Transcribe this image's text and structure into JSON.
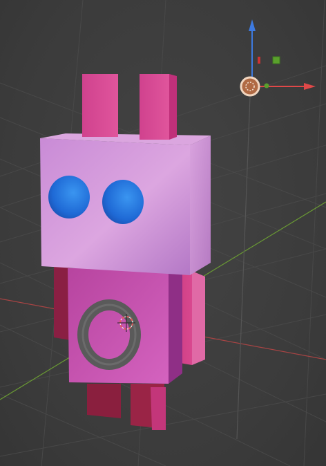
{
  "viewport": {
    "background": "#3d3d3d",
    "grid_color": "#4a4a4a",
    "axis_x_color": "#b54a4a",
    "axis_y_color": "#6f9a3a"
  },
  "gizmo": {
    "z_axis_color": "#4a7fe0",
    "x_axis_color": "#e04a4a",
    "light_icon": "sun-lamp-icon",
    "camera_indicator_color": "#5aa02c",
    "x_label_color": "#c33"
  },
  "robot": {
    "head_color": "#d69ad6",
    "body_color": "#c04fae",
    "ears_color": "#d6438f",
    "eyes_color": "#2f7fe0",
    "ring_color": "#5a5a5a",
    "limbs_color": "#c03a7a"
  },
  "cursor": {
    "icon": "3d-cursor-icon"
  }
}
